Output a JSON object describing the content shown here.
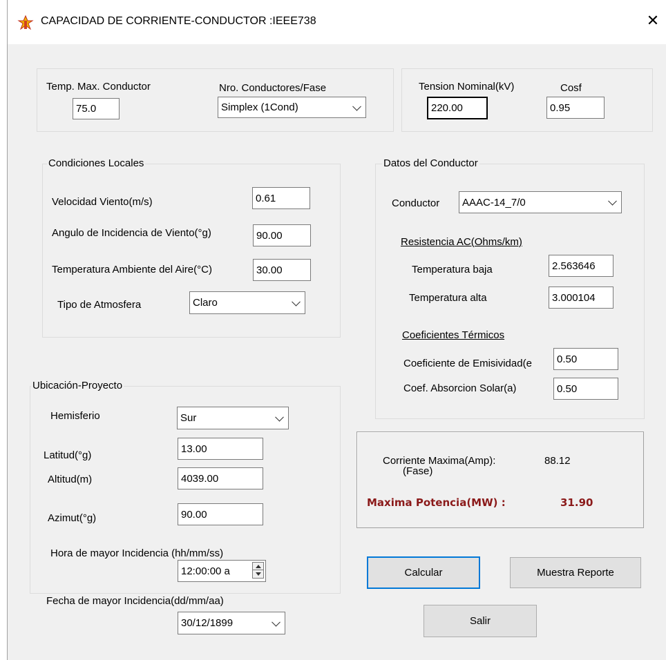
{
  "window": {
    "title": "CAPACIDAD DE CORRIENTE-CONDUCTOR :IEEE738",
    "close_glyph": "✕"
  },
  "top": {
    "temp_max_label": "Temp. Max. Conductor",
    "temp_max_value": "75.0",
    "nro_conductores_label": "Nro. Conductores/Fase",
    "nro_conductores_value": "Simplex (1Cond)",
    "tension_label": "Tension Nominal(kV)",
    "tension_value": "220.00",
    "cosf_label": "Cosf",
    "cosf_value": "0.95"
  },
  "condiciones": {
    "legend": "Condiciones Locales",
    "velocidad_label": "Velocidad Viento(m/s)",
    "velocidad_value": "0.61",
    "angulo_label": "Angulo de Incidencia de Viento(°g)",
    "angulo_value": "90.00",
    "temp_amb_label": "Temperatura Ambiente del Aire(°C)",
    "temp_amb_value": "30.00",
    "atmosfera_label": "Tipo de Atmosfera",
    "atmosfera_value": "Claro"
  },
  "conductor": {
    "legend": "Datos del Conductor",
    "conductor_label": "Conductor",
    "conductor_value": "AAAC-14_7/0",
    "resistencia_heading": "Resistencia AC(Ohms/km)",
    "temp_baja_label": "Temperatura baja",
    "temp_baja_value": "2.563646",
    "temp_alta_label": "Temperatura alta",
    "temp_alta_value": "3.000104",
    "coef_heading": "Coeficientes Térmicos",
    "emisividad_label": "Coeficiente de Emisividad(e",
    "emisividad_value": "0.50",
    "absorcion_label": "Coef. Absorcion Solar(a)",
    "absorcion_value": "0.50"
  },
  "ubicacion": {
    "legend": "Ubicación-Proyecto",
    "hemisferio_label": "Hemisferio",
    "hemisferio_value": "Sur",
    "latitud_label": "Latitud(°g)",
    "latitud_value": "13.00",
    "altitud_label": "Altitud(m)",
    "altitud_value": "4039.00",
    "azimut_label": "Azimut(°g)",
    "azimut_value": "90.00",
    "hora_label": "Hora de mayor Incidencia (hh/mm/ss)",
    "hora_value": "12:00:00 a",
    "fecha_label": "Fecha de mayor Incidencia(dd/mm/aa)",
    "fecha_value": "30/12/1899"
  },
  "results": {
    "corriente_label": "Corriente Maxima(Amp):",
    "corriente_sub": "(Fase)",
    "corriente_value": "88.12",
    "potencia_label": "Maxima Potencia(MW) :",
    "potencia_value": "31.90"
  },
  "buttons": {
    "calcular": "Calcular",
    "reporte": "Muestra Reporte",
    "salir": "Salir"
  }
}
